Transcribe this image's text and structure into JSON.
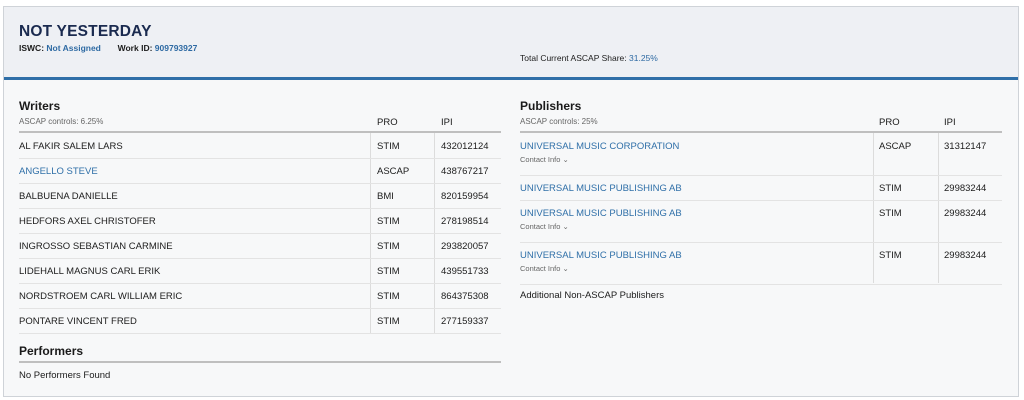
{
  "work": {
    "title": "NOT YESTERDAY",
    "iswc_label": "ISWC:",
    "iswc_value": "Not Assigned",
    "work_id_label": "Work ID:",
    "work_id_value": "909793927",
    "share_label": "Total Current ASCAP Share:",
    "share_value": "31.25%"
  },
  "writers": {
    "title": "Writers",
    "controls": "ASCAP controls: 6.25%",
    "col_pro": "PRO",
    "col_ipi": "IPI",
    "rows": [
      {
        "name": "AL FAKIR SALEM LARS",
        "pro": "STIM",
        "ipi": "432012124"
      },
      {
        "name": "ANGELLO STEVE",
        "pro": "ASCAP",
        "ipi": "438767217"
      },
      {
        "name": "BALBUENA DANIELLE",
        "pro": "BMI",
        "ipi": "820159954"
      },
      {
        "name": "HEDFORS AXEL CHRISTOFER",
        "pro": "STIM",
        "ipi": "278198514"
      },
      {
        "name": "INGROSSO SEBASTIAN CARMINE",
        "pro": "STIM",
        "ipi": "293820057"
      },
      {
        "name": "LIDEHALL MAGNUS CARL ERIK",
        "pro": "STIM",
        "ipi": "439551733"
      },
      {
        "name": "NORDSTROEM CARL WILLIAM ERIC",
        "pro": "STIM",
        "ipi": "864375308"
      },
      {
        "name": "PONTARE VINCENT FRED",
        "pro": "STIM",
        "ipi": "277159337"
      }
    ]
  },
  "performers": {
    "title": "Performers",
    "empty": "No Performers Found"
  },
  "publishers": {
    "title": "Publishers",
    "controls": "ASCAP controls: 25%",
    "col_pro": "PRO",
    "col_ipi": "IPI",
    "contact_label": "Contact Info ⌄",
    "rows": [
      {
        "name": "UNIVERSAL MUSIC CORPORATION",
        "pro": "ASCAP",
        "ipi": "31312147"
      },
      {
        "name": "UNIVERSAL MUSIC PUBLISHING AB",
        "pro": "STIM",
        "ipi": "29983244"
      },
      {
        "name": "UNIVERSAL MUSIC PUBLISHING AB",
        "pro": "STIM",
        "ipi": "29983244"
      },
      {
        "name": "UNIVERSAL MUSIC PUBLISHING AB",
        "pro": "STIM",
        "ipi": "29983244"
      }
    ],
    "additional": "Additional Non-ASCAP Publishers"
  },
  "colors": {
    "link": "#2f6fa8",
    "title": "#1a2a4f",
    "header_bar": "#2f6fa8"
  }
}
